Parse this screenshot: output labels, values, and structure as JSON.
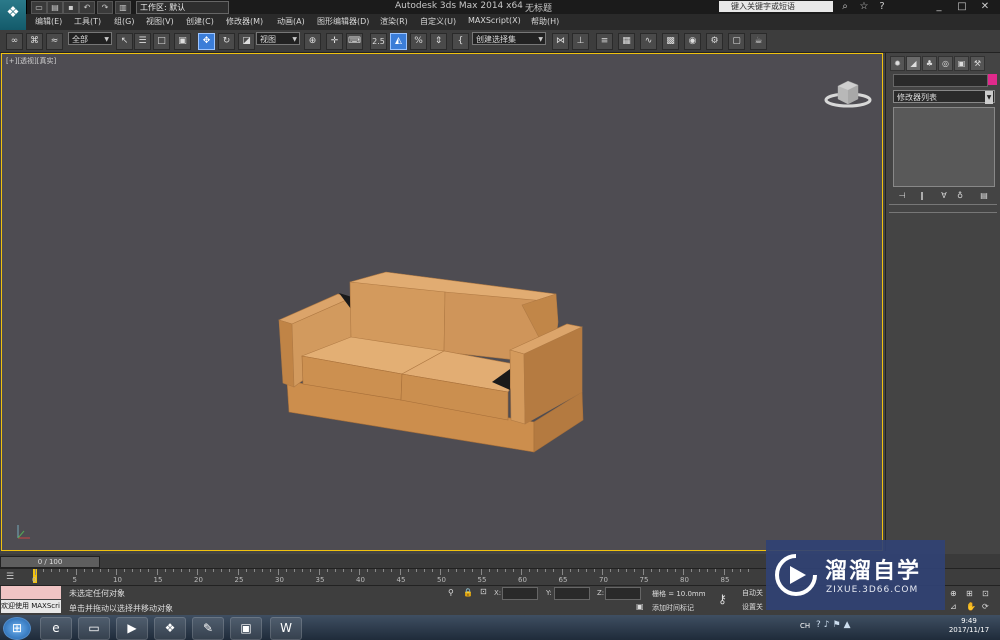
{
  "titlebar": {
    "workspace": "工作区: 默认",
    "app_title": "Autodesk 3ds Max  2014 x64",
    "file_name": "无标题",
    "search_placeholder": "键入关键字或短语"
  },
  "menu": [
    "编辑(E)",
    "工具(T)",
    "组(G)",
    "视图(V)",
    "创建(C)",
    "修改器(M)",
    "动画(A)",
    "图形编辑器(D)",
    "渲染(R)",
    "自定义(U)",
    "MAXScript(X)",
    "帮助(H)"
  ],
  "toolbar": {
    "selection_filter": "全部",
    "ref_coord": "视图",
    "snap_angle": "2.5",
    "named_selection": "创建选择集"
  },
  "viewport": {
    "label": "[+][透视][真实]"
  },
  "command_panel": {
    "modifier_list": "修改器列表",
    "object_color": "#e02a8c"
  },
  "timeline": {
    "slider": "0 / 100",
    "ticks": [
      "0",
      "5",
      "10",
      "15",
      "20",
      "25",
      "30",
      "35",
      "40",
      "45",
      "50",
      "55",
      "60",
      "65",
      "70",
      "75",
      "80",
      "85"
    ]
  },
  "status": {
    "maxscript_label": "欢迎使用 MAXScri",
    "line1": "未选定任何对象",
    "line2": "单击并拖动以选择并移动对象",
    "x_label": "X:",
    "y_label": "Y:",
    "z_label": "Z:",
    "grid": "栅格 = 10.0mm",
    "auto_key": "自动关",
    "set_key": "设置关",
    "add_time_tag": "添加时间标记"
  },
  "taskbar": {
    "lang": "CH",
    "time": "9:49",
    "date": "2017/11/17"
  },
  "watermark": {
    "title": "溜溜自学",
    "url": "ZIXUE.3D66.COM"
  },
  "colors": {
    "viewport_bg": "#4e4c52",
    "sofa": "#cc9050",
    "active_viewport_border": "#f0c20f"
  }
}
